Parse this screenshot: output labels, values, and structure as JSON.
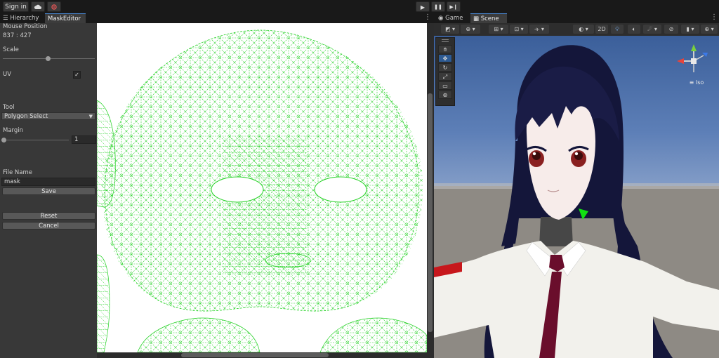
{
  "toolbar": {
    "sign_in_label": "Sign in",
    "cloud_icon": "cloud-icon",
    "collab_icon": "collab-icon",
    "play_icon": "▶",
    "pause_icon": "❚❚",
    "step_icon": "▶❙"
  },
  "left_tabs": [
    {
      "label": "Hierarchy",
      "icon": "hierarchy-icon"
    },
    {
      "label": "MaskEditor"
    }
  ],
  "right_tabs": [
    {
      "label": "Game",
      "icon": "game-icon"
    },
    {
      "label": "Scene",
      "icon": "scene-icon"
    }
  ],
  "mask_editor": {
    "mouse_position_label": "Mouse Position",
    "mouse_position_value": "837 : 427",
    "scale_label": "Scale",
    "scale_value": 0.49,
    "uv_label": "UV",
    "uv_checked": true,
    "tool_label": "Tool",
    "tool_value": "Polygon Select",
    "margin_label": "Margin",
    "margin_value": "1",
    "file_name_label": "File Name",
    "file_name_value": "mask",
    "save_label": "Save",
    "reset_label": "Reset",
    "cancel_label": "Cancel"
  },
  "scene_toolbar": {
    "mode_2d_label": "2D"
  },
  "gizmo": {
    "iso_label": "Iso",
    "x_color": "#e8443a",
    "y_color": "#7ad03c",
    "z_color": "#3c7ae8"
  },
  "colors": {
    "uv_line": "#22d122",
    "accent": "#4a8ad8",
    "hair": "#14163a",
    "tie": "#6a0e2c"
  }
}
